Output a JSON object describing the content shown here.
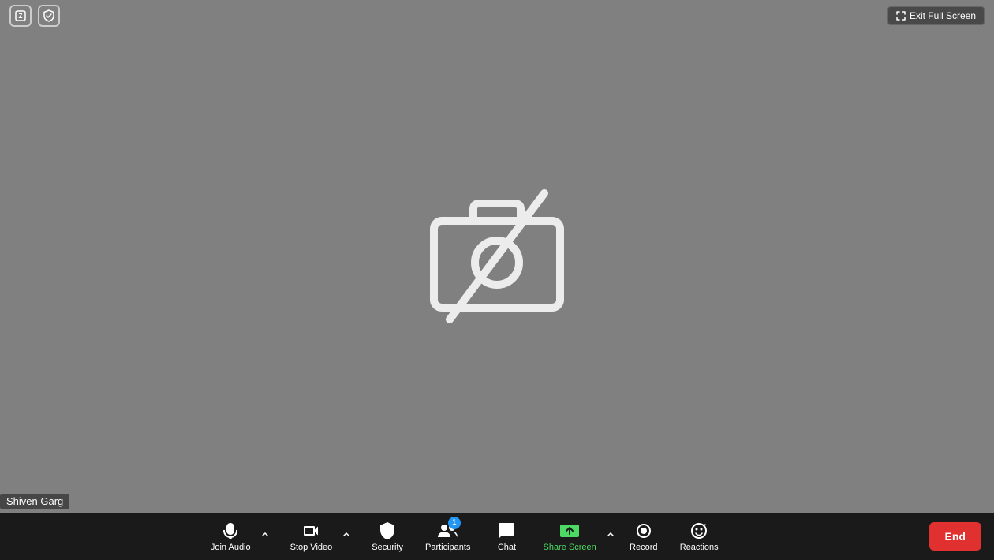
{
  "topBar": {
    "exitFullScreen": "Exit Full Screen"
  },
  "mainArea": {
    "cameraOffAlt": "Camera is off"
  },
  "nameLabel": "Shiven Garg",
  "toolbar": {
    "joinAudio": "Join Audio",
    "stopVideo": "Stop Video",
    "security": "Security",
    "participants": "Participants",
    "participantCount": "1",
    "chat": "Chat",
    "shareScreen": "Share Screen",
    "record": "Record",
    "reactions": "Reactions",
    "end": "End"
  },
  "colors": {
    "shareScreenGreen": "#4cd964",
    "endRed": "#e03030"
  }
}
